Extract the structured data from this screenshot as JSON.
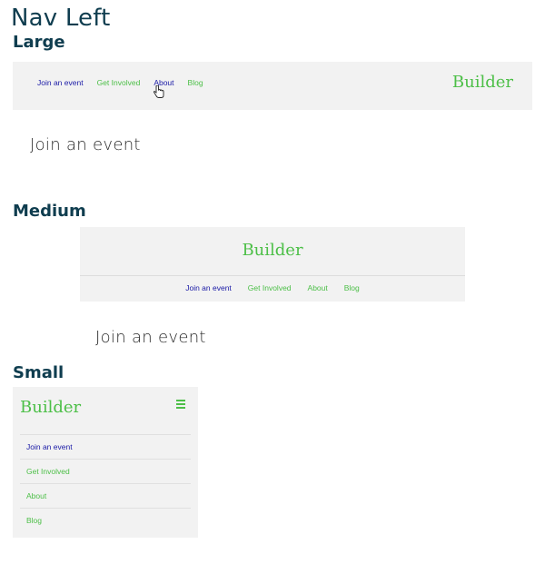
{
  "page": {
    "title": "Nav Left"
  },
  "sections": {
    "large": "Large",
    "medium": "Medium",
    "small": "Small"
  },
  "brand": "Builder",
  "nav": {
    "items": [
      "Join an event",
      "Get Involved",
      "About",
      "Blog"
    ],
    "active_index": 0
  },
  "content": {
    "heading": "Join an event"
  },
  "icons": {
    "menu": "hamburger-icon",
    "cursor": "pointer-hand-icon"
  },
  "colors": {
    "brand": "#4cbf47",
    "active_link": "#1a1aa6",
    "title": "#0f3d4f",
    "bar_bg": "#f2f2f2"
  }
}
